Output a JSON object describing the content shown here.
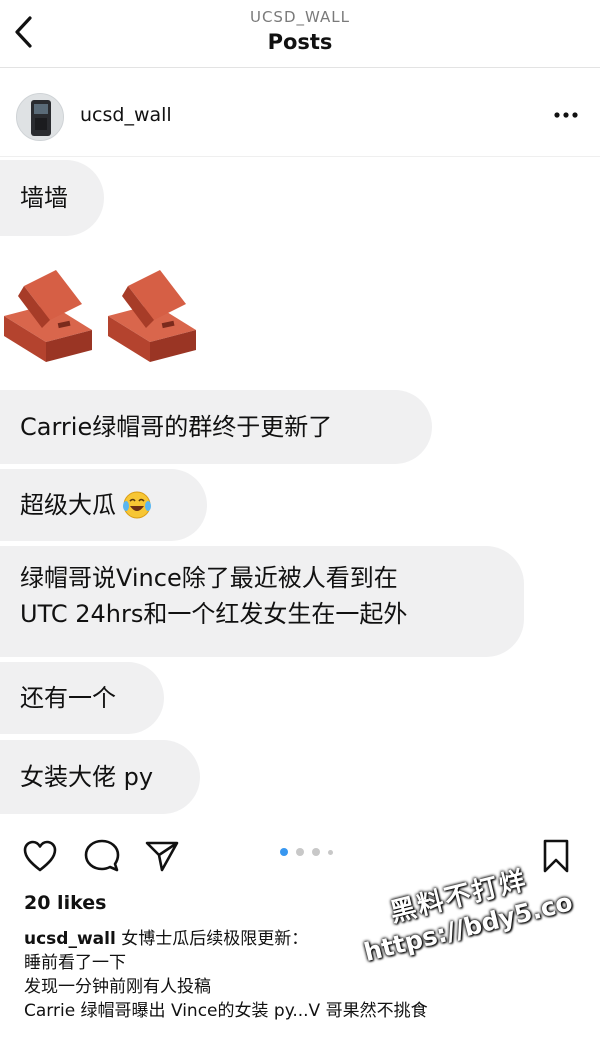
{
  "header": {
    "account": "UCSD_WALL",
    "title": "Posts"
  },
  "post": {
    "username": "ucsd_wall",
    "messages": [
      "墙墙",
      "Carrie绿帽哥的群终于更新了",
      "超级大瓜",
      "绿帽哥说Vince除了最近被人看到在",
      "UTC 24hrs和一个红发女生在一起外",
      "还有一个",
      "女装大佬 py"
    ],
    "emoji_name": "tears-of-joy-emoji",
    "carousel": {
      "total": 4,
      "active": 1
    },
    "likes": "20 likes",
    "caption": {
      "user": "ucsd_wall",
      "line1": "女博士瓜后续极限更新：",
      "line2": "睡前看了一下",
      "line3": "发现一分钟前刚有人投稿",
      "line4": "Carrie 绿帽哥曝出 Vince的女装 py...V 哥果然不挑食"
    }
  },
  "watermark": {
    "line1": "黑料不打烊",
    "line2": "https://bdy5.co"
  },
  "colors": {
    "bubble": "#f0f0f1",
    "carousel_active": "#3897f0",
    "brick": "#c8503a"
  },
  "icons": [
    "back-chevron-icon",
    "more-options-icon",
    "heart-icon",
    "comment-icon",
    "share-icon",
    "bookmark-icon"
  ]
}
